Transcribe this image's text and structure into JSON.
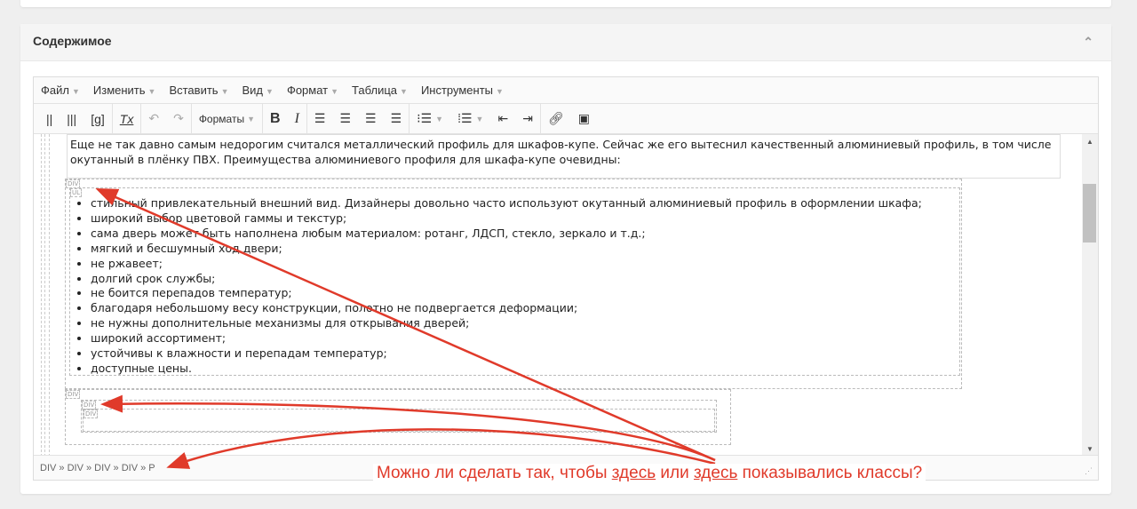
{
  "panel": {
    "title": "Содержимое"
  },
  "menubar": [
    "Файл",
    "Изменить",
    "Вставить",
    "Вид",
    "Формат",
    "Таблица",
    "Инструменты"
  ],
  "toolbar": {
    "b1": "||",
    "b2": "|||",
    "b3": "[g]",
    "clear": "Tx",
    "formats": "Форматы",
    "bold": "B",
    "italic": "I"
  },
  "content": {
    "paragraph": "Еще не так давно самым недорогим считался металлический профиль для шкафов-купе. Сейчас же его вытеснил качественный алюминиевый профиль, в том числе окутанный в плёнку ПВХ. Преимущества алюминиевого профиля для шкафа-купе очевидны:",
    "items": [
      "стильный привлекательный внешний вид. Дизайнеры довольно часто используют окутанный алюминиевый профиль в оформлении шкафа;",
      "широкий выбор цветовой гаммы и текстур;",
      "сама дверь может быть наполнена любым материалом: ротанг, ЛДСП, стекло, зеркало и т.д.;",
      "мягкий и бесшумный ход двери;",
      "не ржавеет;",
      "долгий срок службы;",
      "не боится перепадов температур;",
      "благодаря небольшому весу конструкции, полотно не подвергается деформации;",
      "не нужны дополнительные механизмы для открывания дверей;",
      "широкий ассортимент;",
      "устойчивы к влажности и перепадам температур;",
      "доступные цены."
    ],
    "tag_div": "DIV",
    "tag_ul": "UL"
  },
  "status": {
    "path": "DIV » DIV » DIV » DIV » P"
  },
  "annotation": {
    "before": "Можно ли сделать так, чтобы ",
    "here1": "здесь",
    "mid": " или ",
    "here2": "здесь",
    "after": " показывались классы?",
    "color": "#e03a2a"
  }
}
